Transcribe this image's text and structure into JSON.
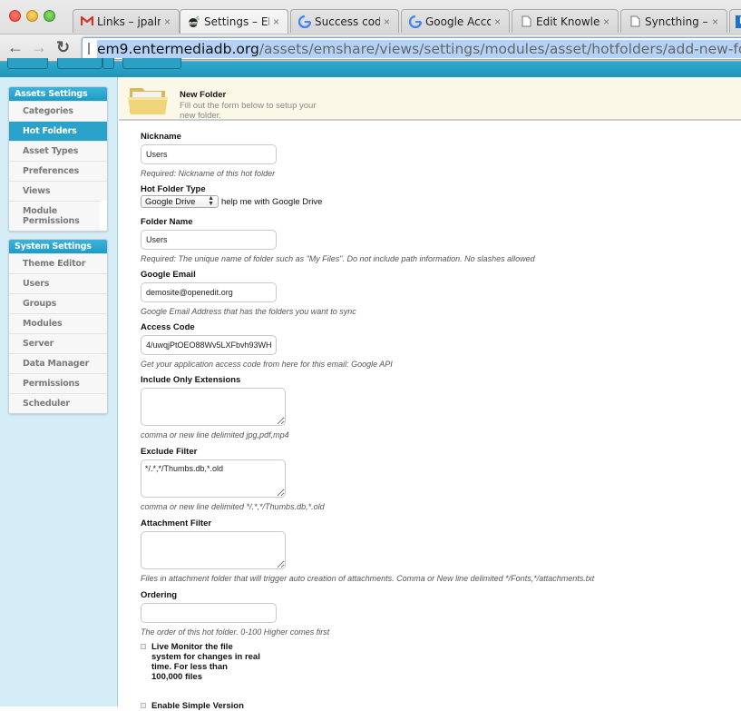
{
  "browser": {
    "tabs": [
      {
        "label": "Links – jpalm",
        "icon": "gmail-icon",
        "active": false
      },
      {
        "label": "Settings – EM",
        "icon": "entermedia-icon",
        "active": true
      },
      {
        "label": "Success code",
        "icon": "google-icon",
        "active": false
      },
      {
        "label": "Google Acco",
        "icon": "google-icon",
        "active": false
      },
      {
        "label": "Edit Knowled",
        "icon": "page-icon",
        "active": false
      },
      {
        "label": "Syncthing – I",
        "icon": "page-icon",
        "active": false
      }
    ],
    "close_glyph": "×",
    "url_host": "em9.entermediadb.org",
    "url_path": "/assets/emshare/views/settings/modules/asset/hotfolders/add-new-folder.html"
  },
  "sidebar": {
    "sections": [
      {
        "title": "Assets Settings",
        "items": [
          {
            "label": "Categories",
            "active": false
          },
          {
            "label": "Hot Folders",
            "active": true
          },
          {
            "label": "Asset Types",
            "active": false
          },
          {
            "label": "Preferences",
            "active": false
          },
          {
            "label": "Views",
            "active": false
          },
          {
            "label": "Module Permissions",
            "active": false
          }
        ]
      },
      {
        "title": "System Settings",
        "items": [
          {
            "label": "Theme Editor",
            "active": false
          },
          {
            "label": "Users",
            "active": false
          },
          {
            "label": "Groups",
            "active": false
          },
          {
            "label": "Modules",
            "active": false
          },
          {
            "label": "Server",
            "active": false
          },
          {
            "label": "Data Manager",
            "active": false
          },
          {
            "label": "Permissions",
            "active": false
          },
          {
            "label": "Scheduler",
            "active": false
          }
        ]
      }
    ]
  },
  "banner": {
    "title": "New Folder",
    "description": "Fill out the form below to setup your new folder."
  },
  "form": {
    "nickname": {
      "label": "Nickname",
      "value": "Users",
      "help": "Required: Nickname of this hot folder"
    },
    "hot_folder_type": {
      "label": "Hot Folder Type",
      "selected": "Google Drive",
      "help_link": "help me with Google Drive"
    },
    "folder_name": {
      "label": "Folder Name",
      "value": "Users",
      "help": "Required: The unique name of folder such as \"My Files\". Do not include path information. No slashes allowed"
    },
    "google_email": {
      "label": "Google Email",
      "value": "demosite@openedit.org",
      "help": "Google Email Address that has the folders you want to sync"
    },
    "access_code": {
      "label": "Access Code",
      "value": "4/uwqjPtOEO88Wv5LXFbvh93WH.",
      "help": "Get your application access code from here for this email: Google API"
    },
    "include_extensions": {
      "label": "Include Only Extensions",
      "value": "",
      "help": "comma or new line delimited jpg,pdf,mp4"
    },
    "exclude_filter": {
      "label": "Exclude Filter",
      "value": "*/.*,*/Thumbs.db,*.old",
      "help": "comma or new line delimited */.*,*/Thumbs.db,*.old"
    },
    "attachment_filter": {
      "label": "Attachment Filter",
      "value": "",
      "help": "Files in attachment folder that will trigger auto creation of attachments. Comma or New line delimited */Fonts,*/attachments.txt"
    },
    "ordering": {
      "label": "Ordering",
      "value": "",
      "help": "The order of this hot folder. 0-100 Higher comes first"
    },
    "live_monitor": {
      "label": "Live Monitor the file system for changes in real time. For less than 100,000 files",
      "checked": false
    },
    "simple_version": {
      "label": "Enable Simple Version",
      "checked": false
    }
  }
}
